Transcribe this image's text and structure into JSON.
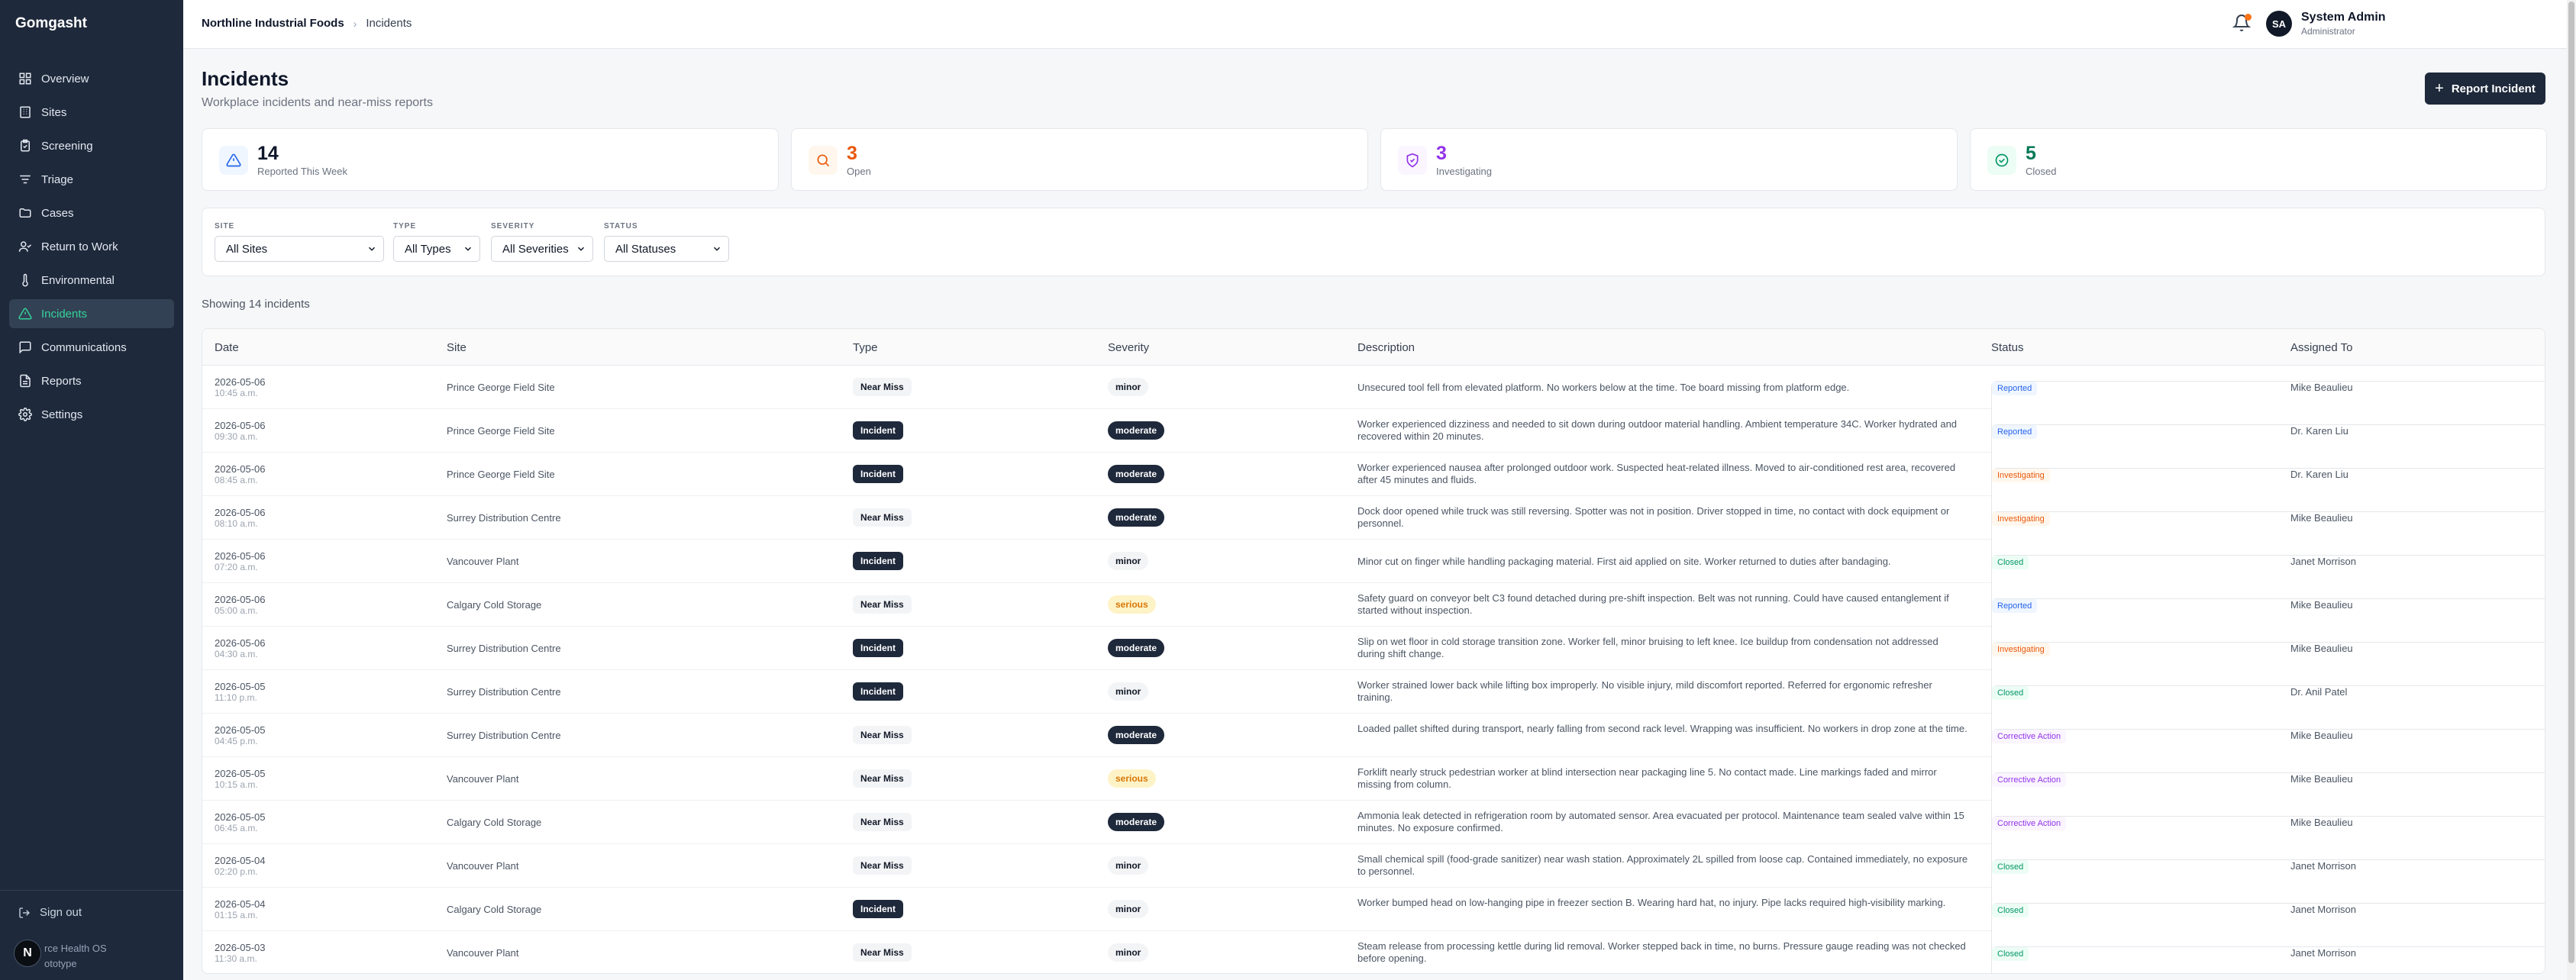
{
  "app": {
    "brand": "Gomgasht"
  },
  "nav": [
    {
      "id": "overview",
      "label": "Overview",
      "icon": "grid-icon",
      "active": false
    },
    {
      "id": "sites",
      "label": "Sites",
      "icon": "building-icon",
      "active": false
    },
    {
      "id": "screening",
      "label": "Screening",
      "icon": "clipboard-check-icon",
      "active": false
    },
    {
      "id": "triage",
      "label": "Triage",
      "icon": "filter-lines-icon",
      "active": false
    },
    {
      "id": "cases",
      "label": "Cases",
      "icon": "folder-icon",
      "active": false
    },
    {
      "id": "return-to-work",
      "label": "Return to Work",
      "icon": "user-check-icon",
      "active": false
    },
    {
      "id": "environmental",
      "label": "Environmental",
      "icon": "thermometer-icon",
      "active": false
    },
    {
      "id": "incidents",
      "label": "Incidents",
      "icon": "alert-triangle-icon",
      "active": true
    },
    {
      "id": "communications",
      "label": "Communications",
      "icon": "message-icon",
      "active": false
    },
    {
      "id": "reports",
      "label": "Reports",
      "icon": "file-text-icon",
      "active": false
    },
    {
      "id": "settings",
      "label": "Settings",
      "icon": "gear-icon",
      "active": false
    }
  ],
  "sidebar_footer": {
    "signout": "Sign out",
    "avatar_letter": "N",
    "product_line1": "rce Health OS",
    "product_line2": "ototype"
  },
  "breadcrumb": {
    "org": "Northline Industrial Foods",
    "sep": "›",
    "page": "Incidents"
  },
  "user": {
    "initials": "SA",
    "name": "System Admin",
    "role": "Administrator"
  },
  "page": {
    "title": "Incidents",
    "subtitle": "Workplace incidents and near-miss reports",
    "report_button": "Report Incident",
    "report_plus": "+"
  },
  "stats": [
    {
      "value": "14",
      "label": "Reported This Week",
      "color": "#0f172a",
      "icon": "alert-triangle-icon",
      "icon_color": "#2563eb",
      "icon_bg": "#eff6ff"
    },
    {
      "value": "3",
      "label": "Open",
      "color": "#ea580c",
      "icon": "search-icon",
      "icon_color": "#ea580c",
      "icon_bg": "#fff7ed"
    },
    {
      "value": "3",
      "label": "Investigating",
      "color": "#9333ea",
      "icon": "shield-check-icon",
      "icon_color": "#9333ea",
      "icon_bg": "#faf5ff"
    },
    {
      "value": "5",
      "label": "Closed",
      "color": "#047857",
      "icon": "check-circle-icon",
      "icon_color": "#059669",
      "icon_bg": "#ecfdf5"
    }
  ],
  "filters": [
    {
      "label": "SITE",
      "value": "All Sites"
    },
    {
      "label": "TYPE",
      "value": "All Types"
    },
    {
      "label": "SEVERITY",
      "value": "All Severities"
    },
    {
      "label": "STATUS",
      "value": "All Statuses"
    }
  ],
  "showing": "Showing 14 incidents",
  "table": {
    "headers": [
      "Date",
      "Site",
      "Type",
      "Severity",
      "Description",
      "Status",
      "Assigned To"
    ],
    "rows": [
      {
        "date": "2026-05-06",
        "time": "10:45 a.m.",
        "site": "Prince George Field Site",
        "type": "Near Miss",
        "severity": "minor",
        "description": "Unsecured tool fell from elevated platform. No workers below at the time. Toe board missing from platform edge.",
        "status": "Reported",
        "assigned": "Mike Beaulieu"
      },
      {
        "date": "2026-05-06",
        "time": "09:30 a.m.",
        "site": "Prince George Field Site",
        "type": "Incident",
        "severity": "moderate",
        "description": "Worker experienced dizziness and needed to sit down during outdoor material handling. Ambient temperature 34C. Worker hydrated and recovered within 20 minutes.",
        "status": "Reported",
        "assigned": "Dr. Karen Liu"
      },
      {
        "date": "2026-05-06",
        "time": "08:45 a.m.",
        "site": "Prince George Field Site",
        "type": "Incident",
        "severity": "moderate",
        "description": "Worker experienced nausea after prolonged outdoor work. Suspected heat-related illness. Moved to air-conditioned rest area, recovered after 45 minutes and fluids.",
        "status": "Investigating",
        "assigned": "Dr. Karen Liu"
      },
      {
        "date": "2026-05-06",
        "time": "08:10 a.m.",
        "site": "Surrey Distribution Centre",
        "type": "Near Miss",
        "severity": "moderate",
        "description": "Dock door opened while truck was still reversing. Spotter was not in position. Driver stopped in time, no contact with dock equipment or personnel.",
        "status": "Investigating",
        "assigned": "Mike Beaulieu"
      },
      {
        "date": "2026-05-06",
        "time": "07:20 a.m.",
        "site": "Vancouver Plant",
        "type": "Incident",
        "severity": "minor",
        "description": "Minor cut on finger while handling packaging material. First aid applied on site. Worker returned to duties after bandaging.",
        "status": "Closed",
        "assigned": "Janet Morrison"
      },
      {
        "date": "2026-05-06",
        "time": "05:00 a.m.",
        "site": "Calgary Cold Storage",
        "type": "Near Miss",
        "severity": "serious",
        "description": "Safety guard on conveyor belt C3 found detached during pre-shift inspection. Belt was not running. Could have caused entanglement if started without inspection.",
        "status": "Reported",
        "assigned": "Mike Beaulieu"
      },
      {
        "date": "2026-05-06",
        "time": "04:30 a.m.",
        "site": "Surrey Distribution Centre",
        "type": "Incident",
        "severity": "moderate",
        "description": "Slip on wet floor in cold storage transition zone. Worker fell, minor bruising to left knee. Ice buildup from condensation not addressed during shift change.",
        "status": "Investigating",
        "assigned": "Mike Beaulieu"
      },
      {
        "date": "2026-05-05",
        "time": "11:10 p.m.",
        "site": "Surrey Distribution Centre",
        "type": "Incident",
        "severity": "minor",
        "description": "Worker strained lower back while lifting box improperly. No visible injury, mild discomfort reported. Referred for ergonomic refresher training.",
        "status": "Closed",
        "assigned": "Dr. Anil Patel"
      },
      {
        "date": "2026-05-05",
        "time": "04:45 p.m.",
        "site": "Surrey Distribution Centre",
        "type": "Near Miss",
        "severity": "moderate",
        "description": "Loaded pallet shifted during transport, nearly falling from second rack level. Wrapping was insufficient. No workers in drop zone at the time.",
        "status": "Corrective Action",
        "assigned": "Mike Beaulieu"
      },
      {
        "date": "2026-05-05",
        "time": "10:15 a.m.",
        "site": "Vancouver Plant",
        "type": "Near Miss",
        "severity": "serious",
        "description": "Forklift nearly struck pedestrian worker at blind intersection near packaging line 5. No contact made. Line markings faded and mirror missing from column.",
        "status": "Corrective Action",
        "assigned": "Mike Beaulieu"
      },
      {
        "date": "2026-05-05",
        "time": "06:45 a.m.",
        "site": "Calgary Cold Storage",
        "type": "Near Miss",
        "severity": "moderate",
        "description": "Ammonia leak detected in refrigeration room by automated sensor. Area evacuated per protocol. Maintenance team sealed valve within 15 minutes. No exposure confirmed.",
        "status": "Corrective Action",
        "assigned": "Mike Beaulieu"
      },
      {
        "date": "2026-05-04",
        "time": "02:20 p.m.",
        "site": "Vancouver Plant",
        "type": "Near Miss",
        "severity": "minor",
        "description": "Small chemical spill (food-grade sanitizer) near wash station. Approximately 2L spilled from loose cap. Contained immediately, no exposure to personnel.",
        "status": "Closed",
        "assigned": "Janet Morrison"
      },
      {
        "date": "2026-05-04",
        "time": "01:15 a.m.",
        "site": "Calgary Cold Storage",
        "type": "Incident",
        "severity": "minor",
        "description": "Worker bumped head on low-hanging pipe in freezer section B. Wearing hard hat, no injury. Pipe lacks required high-visibility marking.",
        "status": "Closed",
        "assigned": "Janet Morrison"
      },
      {
        "date": "2026-05-03",
        "time": "11:30 a.m.",
        "site": "Vancouver Plant",
        "type": "Near Miss",
        "severity": "minor",
        "description": "Steam release from processing kettle during lid removal. Worker stepped back in time, no burns. Pressure gauge reading was not checked before opening.",
        "status": "Closed",
        "assigned": "Janet Morrison"
      }
    ]
  }
}
